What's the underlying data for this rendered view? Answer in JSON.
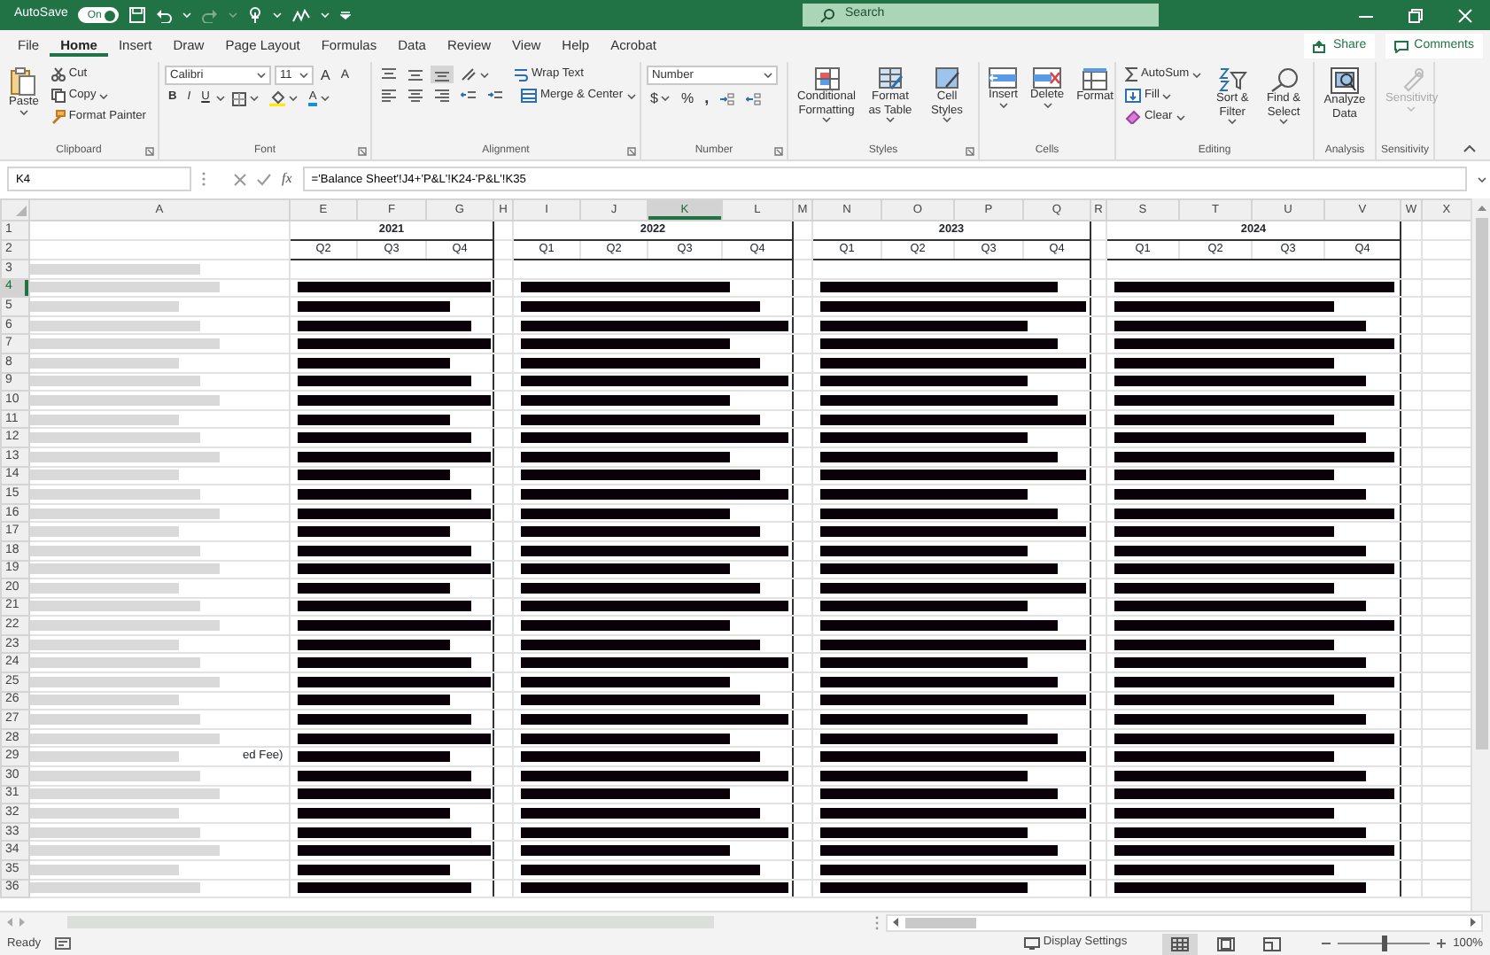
{
  "title_bar": {
    "autosave_label": "AutoSave",
    "autosave_toggle": {
      "label": "On",
      "on": true
    },
    "search": {
      "placeholder": "Search"
    }
  },
  "menu_tabs": [
    {
      "label": "File",
      "selected": false
    },
    {
      "label": "Home",
      "selected": true
    },
    {
      "label": "Insert",
      "selected": false
    },
    {
      "label": "Draw",
      "selected": false
    },
    {
      "label": "Page Layout",
      "selected": false
    },
    {
      "label": "Formulas",
      "selected": false
    },
    {
      "label": "Data",
      "selected": false
    },
    {
      "label": "Review",
      "selected": false
    },
    {
      "label": "View",
      "selected": false
    },
    {
      "label": "Help",
      "selected": false
    },
    {
      "label": "Acrobat",
      "selected": false
    }
  ],
  "share_button": "Share",
  "comments_button": "Comments",
  "ribbon": {
    "clipboard": {
      "title": "Clipboard",
      "paste": "Paste",
      "cut": "Cut",
      "copy": "Copy",
      "format_painter": "Format Painter"
    },
    "font": {
      "title": "Font",
      "font_name": "Calibri",
      "font_size": "11",
      "grow_font": "A",
      "shrink_font": "A",
      "styles": [
        "B",
        "I",
        "U"
      ],
      "font_color": "A"
    },
    "alignment": {
      "title": "Alignment",
      "wrap_text": "Wrap Text",
      "merge_center": "Merge & Center"
    },
    "number": {
      "title": "Number",
      "format": "Number",
      "currency": "$",
      "percent": "%",
      "comma": ","
    },
    "styles": {
      "title": "Styles",
      "buttons": [
        "Conditional Formatting",
        "Format as Table",
        "Cell Styles"
      ]
    },
    "cells": {
      "title": "Cells",
      "buttons": [
        "Insert",
        "Delete",
        "Format"
      ]
    },
    "editing": {
      "title": "Editing",
      "autosum": "AutoSum",
      "fill": "Fill",
      "clear": "Clear",
      "sort_filter": "Sort & Filter",
      "find_select": "Find & Select"
    },
    "analysis": {
      "title": "Analysis",
      "button": "Analyze Data"
    },
    "sensitivity": {
      "title": "Sensitivity",
      "button": "Sensitivity",
      "disabled": true
    }
  },
  "formula_bar": {
    "name_box": "K4",
    "function_label": "fx",
    "formula": "='Balance Sheet'!J4+'P&L'!K24-'P&L'!K35"
  },
  "sheet": {
    "columns": [
      {
        "label": "A",
        "selected": false
      },
      {
        "label": "E",
        "selected": false
      },
      {
        "label": "F",
        "selected": false
      },
      {
        "label": "G",
        "selected": false
      },
      {
        "label": "H",
        "selected": false
      },
      {
        "label": "I",
        "selected": false
      },
      {
        "label": "J",
        "selected": false
      },
      {
        "label": "K",
        "selected": true
      },
      {
        "label": "L",
        "selected": false
      },
      {
        "label": "M",
        "selected": false
      },
      {
        "label": "N",
        "selected": false
      },
      {
        "label": "O",
        "selected": false
      },
      {
        "label": "P",
        "selected": false
      },
      {
        "label": "Q",
        "selected": false
      },
      {
        "label": "R",
        "selected": false
      },
      {
        "label": "S",
        "selected": false
      },
      {
        "label": "T",
        "selected": false
      },
      {
        "label": "U",
        "selected": false
      },
      {
        "label": "V",
        "selected": false
      },
      {
        "label": "W",
        "selected": false
      },
      {
        "label": "X",
        "selected": false
      }
    ],
    "year_groups": [
      {
        "year": "2021",
        "quarters": [
          "Q2",
          "Q3",
          "Q4"
        ]
      },
      {
        "year": "2022",
        "quarters": [
          "Q1",
          "Q2",
          "Q3",
          "Q4"
        ]
      },
      {
        "year": "2023",
        "quarters": [
          "Q1",
          "Q2",
          "Q3",
          "Q4"
        ]
      },
      {
        "year": "2024",
        "quarters": [
          "Q1",
          "Q2",
          "Q3",
          "Q4"
        ]
      }
    ],
    "rows": [
      {
        "label": "1",
        "selected": false
      },
      {
        "label": "2",
        "selected": false
      },
      {
        "label": "3",
        "selected": false
      },
      {
        "label": "4",
        "selected": true
      },
      {
        "label": "5",
        "selected": false
      },
      {
        "label": "6",
        "selected": false
      },
      {
        "label": "7",
        "selected": false
      },
      {
        "label": "8",
        "selected": false
      },
      {
        "label": "9",
        "selected": false
      },
      {
        "label": "10",
        "selected": false
      },
      {
        "label": "11",
        "selected": false
      },
      {
        "label": "12",
        "selected": false
      },
      {
        "label": "13",
        "selected": false
      },
      {
        "label": "14",
        "selected": false
      },
      {
        "label": "15",
        "selected": false
      },
      {
        "label": "16",
        "selected": false
      },
      {
        "label": "17",
        "selected": false
      },
      {
        "label": "18",
        "selected": false
      },
      {
        "label": "19",
        "selected": false
      },
      {
        "label": "20",
        "selected": false
      },
      {
        "label": "21",
        "selected": false
      },
      {
        "label": "22",
        "selected": false
      },
      {
        "label": "23",
        "selected": false
      },
      {
        "label": "24",
        "selected": false
      },
      {
        "label": "25",
        "selected": false
      },
      {
        "label": "26",
        "selected": false
      },
      {
        "label": "27",
        "selected": false
      },
      {
        "label": "28",
        "selected": false
      },
      {
        "label": "29",
        "selected": false,
        "column_a_text": "ed Fee)"
      },
      {
        "label": "30",
        "selected": false
      },
      {
        "label": "31",
        "selected": false
      },
      {
        "label": "32",
        "selected": false
      },
      {
        "label": "33",
        "selected": false
      },
      {
        "label": "34",
        "selected": false
      },
      {
        "label": "35",
        "selected": false
      },
      {
        "label": "36",
        "selected": false
      }
    ]
  },
  "status_bar": {
    "status": "Ready",
    "display_settings": "Display Settings",
    "views": [
      {
        "kind": "normal",
        "selected": true
      },
      {
        "kind": "page_layout",
        "selected": false
      },
      {
        "kind": "page_break",
        "selected": false
      }
    ],
    "zoom": {
      "level": 0.5,
      "reading": "100%"
    }
  }
}
